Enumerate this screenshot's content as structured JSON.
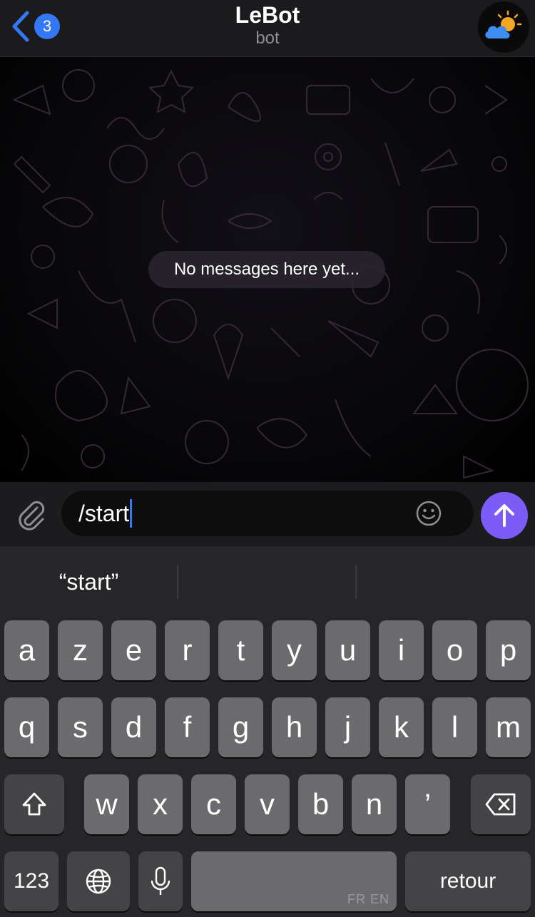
{
  "header": {
    "back_badge": "3",
    "title": "LeBot",
    "subtitle": "bot"
  },
  "chat": {
    "empty_text": "No messages here yet..."
  },
  "composer": {
    "text": "/start"
  },
  "keyboard": {
    "suggestions": [
      "“start”",
      "",
      ""
    ],
    "row1": [
      "a",
      "z",
      "e",
      "r",
      "t",
      "y",
      "u",
      "i",
      "o",
      "p"
    ],
    "row2": [
      "q",
      "s",
      "d",
      "f",
      "g",
      "h",
      "j",
      "k",
      "l",
      "m"
    ],
    "row3": [
      "w",
      "x",
      "c",
      "v",
      "b",
      "n",
      "’"
    ],
    "numbers_label": "123",
    "return_label": "retour",
    "space_hint": "FR EN"
  },
  "colors": {
    "accent": "#3478f6",
    "send": "#7c5cf7",
    "key": "#6b6b6e",
    "key_dark": "#444446"
  },
  "icons": [
    "chevron-left-icon",
    "weather-icon",
    "paperclip-icon",
    "emoji-icon",
    "arrow-up-icon",
    "shift-icon",
    "backspace-icon",
    "globe-icon",
    "microphone-icon"
  ]
}
